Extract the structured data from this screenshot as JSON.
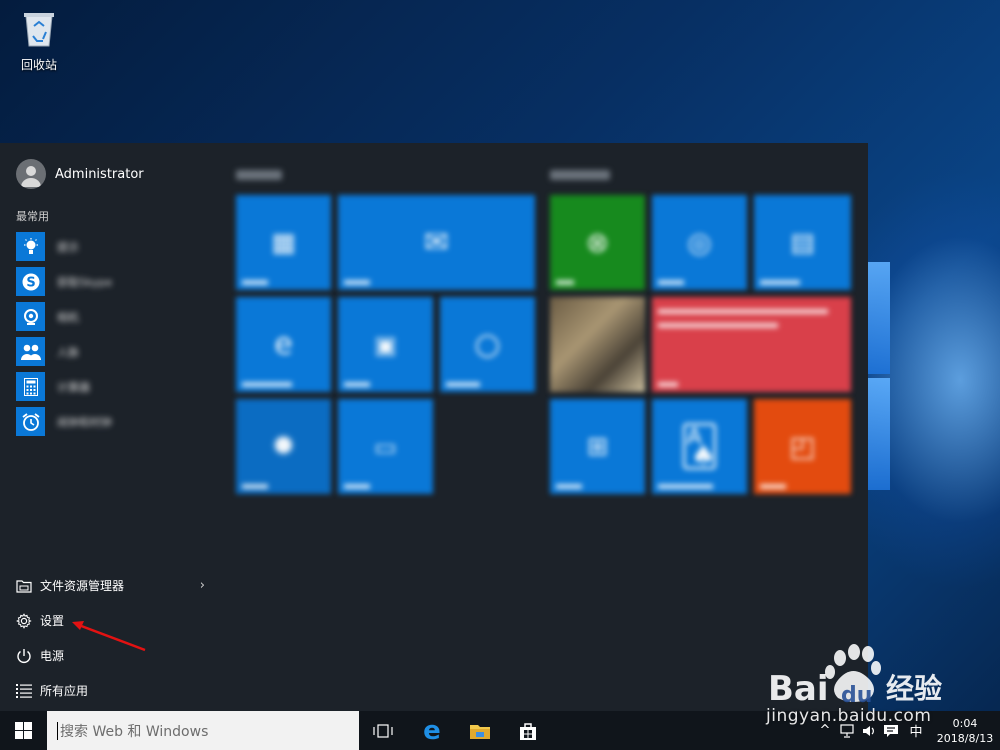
{
  "desktop": {
    "recycle_bin_label": "回收站"
  },
  "start_menu": {
    "user_name": "Administrator",
    "most_used_label": "最常用",
    "most_used_apps": [
      {
        "icon": "lightbulb-icon",
        "name": "提示"
      },
      {
        "icon": "skype-icon",
        "name": "获取Skype"
      },
      {
        "icon": "camera-icon",
        "name": "相机"
      },
      {
        "icon": "people-icon",
        "name": "人脉"
      },
      {
        "icon": "calculator-icon",
        "name": "计算器"
      },
      {
        "icon": "alarm-icon",
        "name": "闹钟和时钟"
      }
    ],
    "bottom_items": {
      "file_explorer": "文件资源管理器",
      "settings": "设置",
      "power": "电源",
      "all_apps": "所有应用"
    },
    "tile_groups": [
      "生活动态",
      "播放和浏览"
    ]
  },
  "taskbar": {
    "search_placeholder": "搜索 Web 和 Windows",
    "ime_label": "中",
    "clock_time": "0:04",
    "clock_date": "2018/8/13"
  },
  "watermark": {
    "brand": "Bai du 经验",
    "url": "jingyan.baidu.com"
  },
  "colors": {
    "tile_blue": "#0a78d7",
    "tile_green": "#178a1e",
    "tile_red": "#d9404a",
    "tile_orange": "#e34b0f",
    "arrow_red": "#e31212"
  }
}
